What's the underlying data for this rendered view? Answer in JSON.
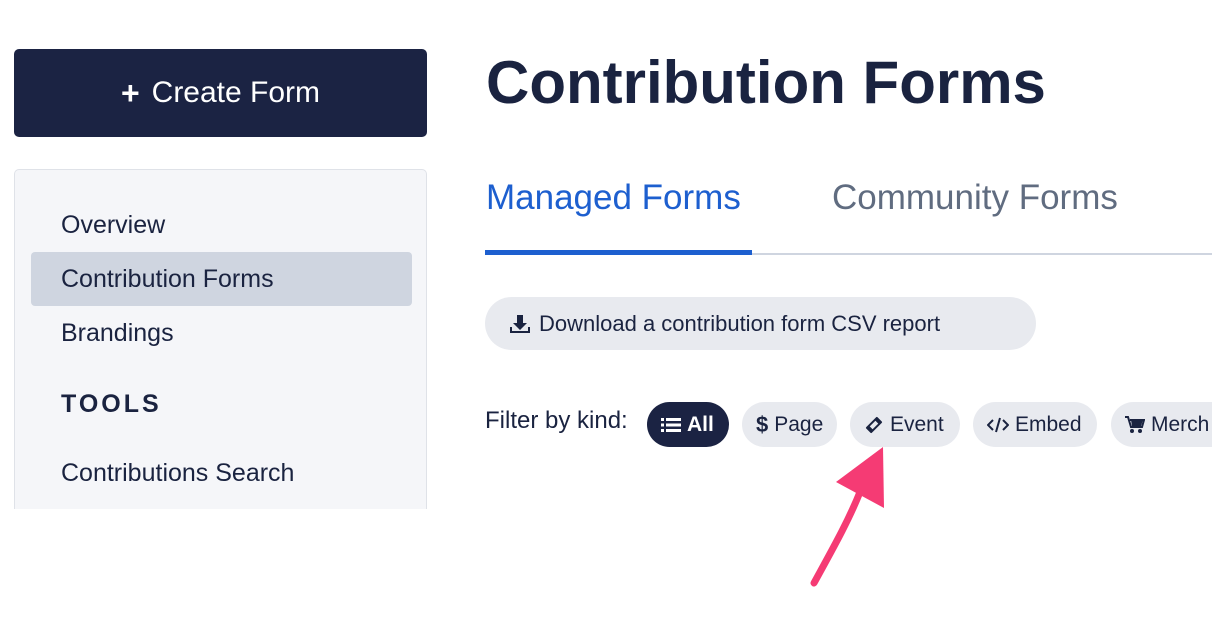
{
  "sidebar": {
    "create_button": {
      "icon": "plus-icon",
      "label": "Create Form"
    },
    "nav_items": [
      {
        "label": "Overview",
        "active": false
      },
      {
        "label": "Contribution Forms",
        "active": true
      },
      {
        "label": "Brandings",
        "active": false
      }
    ],
    "tools_heading": "TOOLS",
    "tools_items": [
      {
        "label": "Contributions Search"
      }
    ]
  },
  "main": {
    "title": "Contribution Forms",
    "tabs": [
      {
        "label": "Managed Forms",
        "active": true
      },
      {
        "label": "Community Forms",
        "active": false
      }
    ],
    "download_button": {
      "icon": "download-icon",
      "label": "Download a contribution form CSV report"
    },
    "filter": {
      "label": "Filter by kind:",
      "chips": [
        {
          "label": "All",
          "icon": "list-icon",
          "active": true
        },
        {
          "label": "Page",
          "icon": "dollar-icon",
          "active": false
        },
        {
          "label": "Event",
          "icon": "ticket-icon",
          "active": false
        },
        {
          "label": "Embed",
          "icon": "code-icon",
          "active": false
        },
        {
          "label": "Merch",
          "icon": "cart-icon",
          "active": false
        }
      ]
    }
  },
  "annotation": {
    "icon": "pointer-arrow-icon",
    "color": "#f53b74"
  },
  "colors": {
    "navy": "#1b2343",
    "accent_blue": "#1d5fcf",
    "chip_bg": "#e8eaef",
    "active_nav_bg": "#cfd5e0"
  }
}
